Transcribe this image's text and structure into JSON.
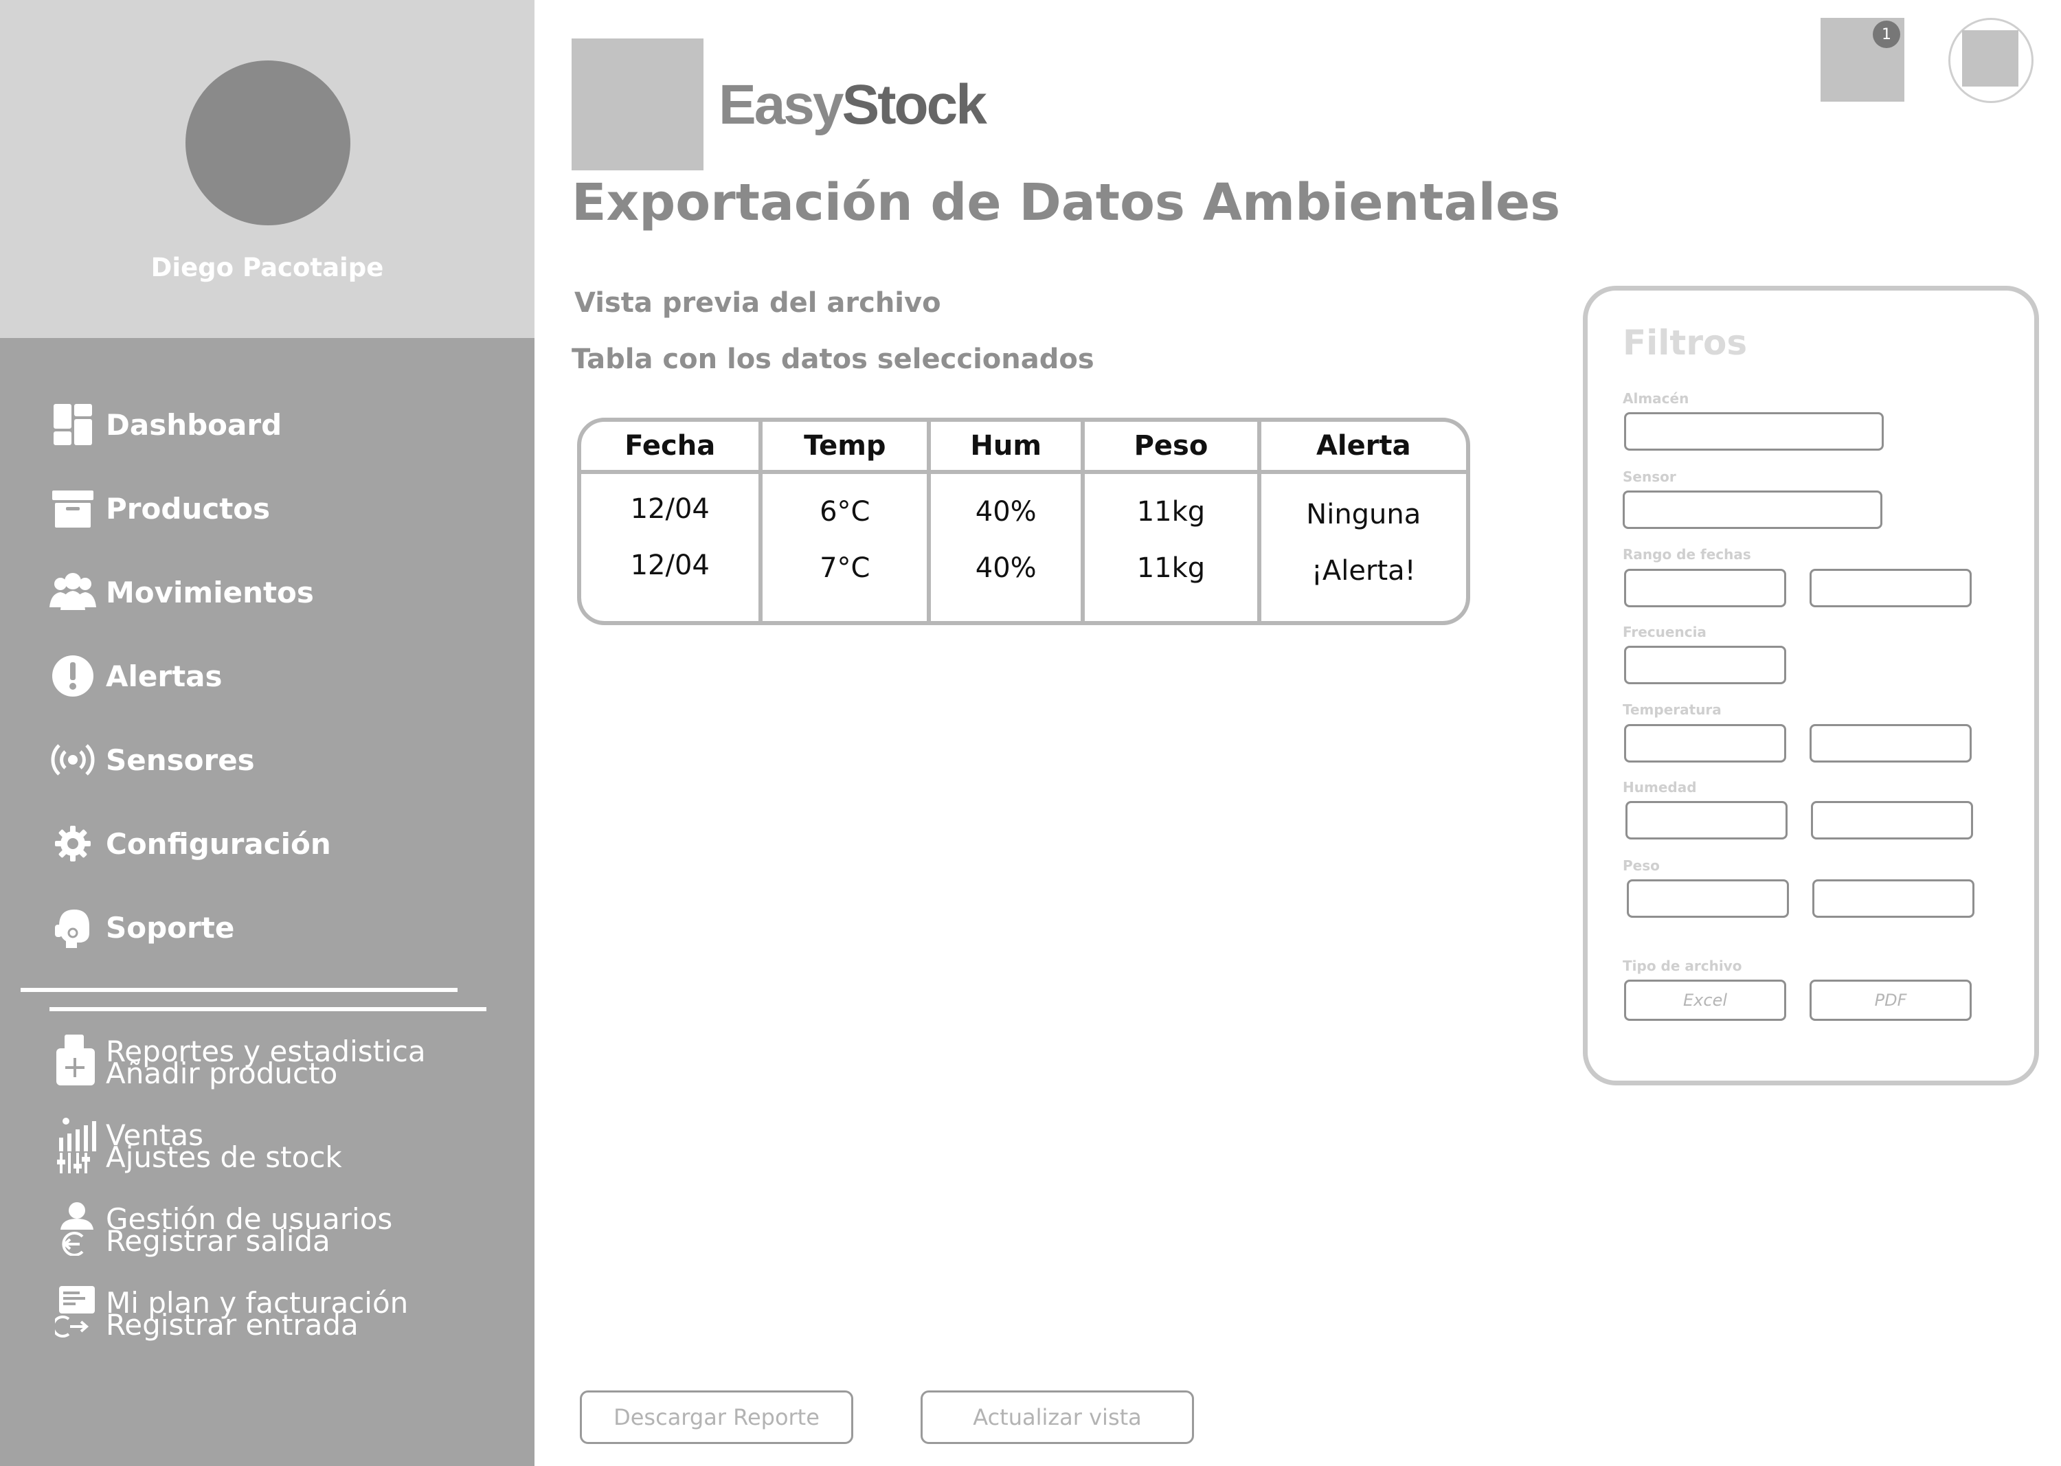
{
  "sidebar": {
    "user_name": "Diego Pacotaipe",
    "items": [
      {
        "label": "Dashboard",
        "icon": "dashboard-icon"
      },
      {
        "label": "Productos",
        "icon": "archive-box-icon"
      },
      {
        "label": "Movimientos",
        "icon": "users-icon"
      },
      {
        "label": "Alertas",
        "icon": "alert-icon"
      },
      {
        "label": "Sensores",
        "icon": "sensor-signal-icon"
      },
      {
        "label": "Configuración",
        "icon": "gear-icon"
      },
      {
        "label": "Soporte",
        "icon": "support-headset-icon"
      }
    ],
    "overlapping": [
      {
        "a": "Reportes y estadistica",
        "b": "Añadir producto",
        "icon": "report-add-icon"
      },
      {
        "a": "Ventas",
        "b": "Ajustes de stock",
        "icon": "sales-chart-icon"
      },
      {
        "a": "Gestión de usuarios",
        "b": "Registrar salida",
        "icon": "user-exit-icon"
      },
      {
        "a": "Mi plan y facturación",
        "b": "Registrar entrada",
        "icon": "billing-entry-icon"
      }
    ]
  },
  "header": {
    "brand_easy": "Easy",
    "brand_stock": "Stock",
    "notification_count": "1"
  },
  "main": {
    "title": "Exportación de Datos Ambientales",
    "preview_label": "Vista previa del archivo",
    "table_label": "Tabla con los datos seleccionados",
    "table": {
      "columns": [
        "Fecha",
        "Temp",
        "Hum",
        "Peso",
        "Alerta"
      ],
      "rows": [
        [
          "12/04",
          "6°C",
          "40%",
          "11kg",
          "Ninguna"
        ],
        [
          "12/04",
          "7°C",
          "40%",
          "11kg",
          "¡Alerta!"
        ]
      ]
    },
    "download_button": "Descargar Reporte",
    "refresh_button": "Actualizar vista"
  },
  "filters": {
    "title": "Filtros",
    "almacen": "Almacén",
    "sensor": "Sensor",
    "rango": "Rango de fechas",
    "frecuencia": "Frecuencia",
    "temperatura": "Temperatura",
    "humedad": "Humedad",
    "peso": "Peso",
    "tipo": "Tipo de archivo",
    "excel": "Excel",
    "pdf": "PDF"
  }
}
